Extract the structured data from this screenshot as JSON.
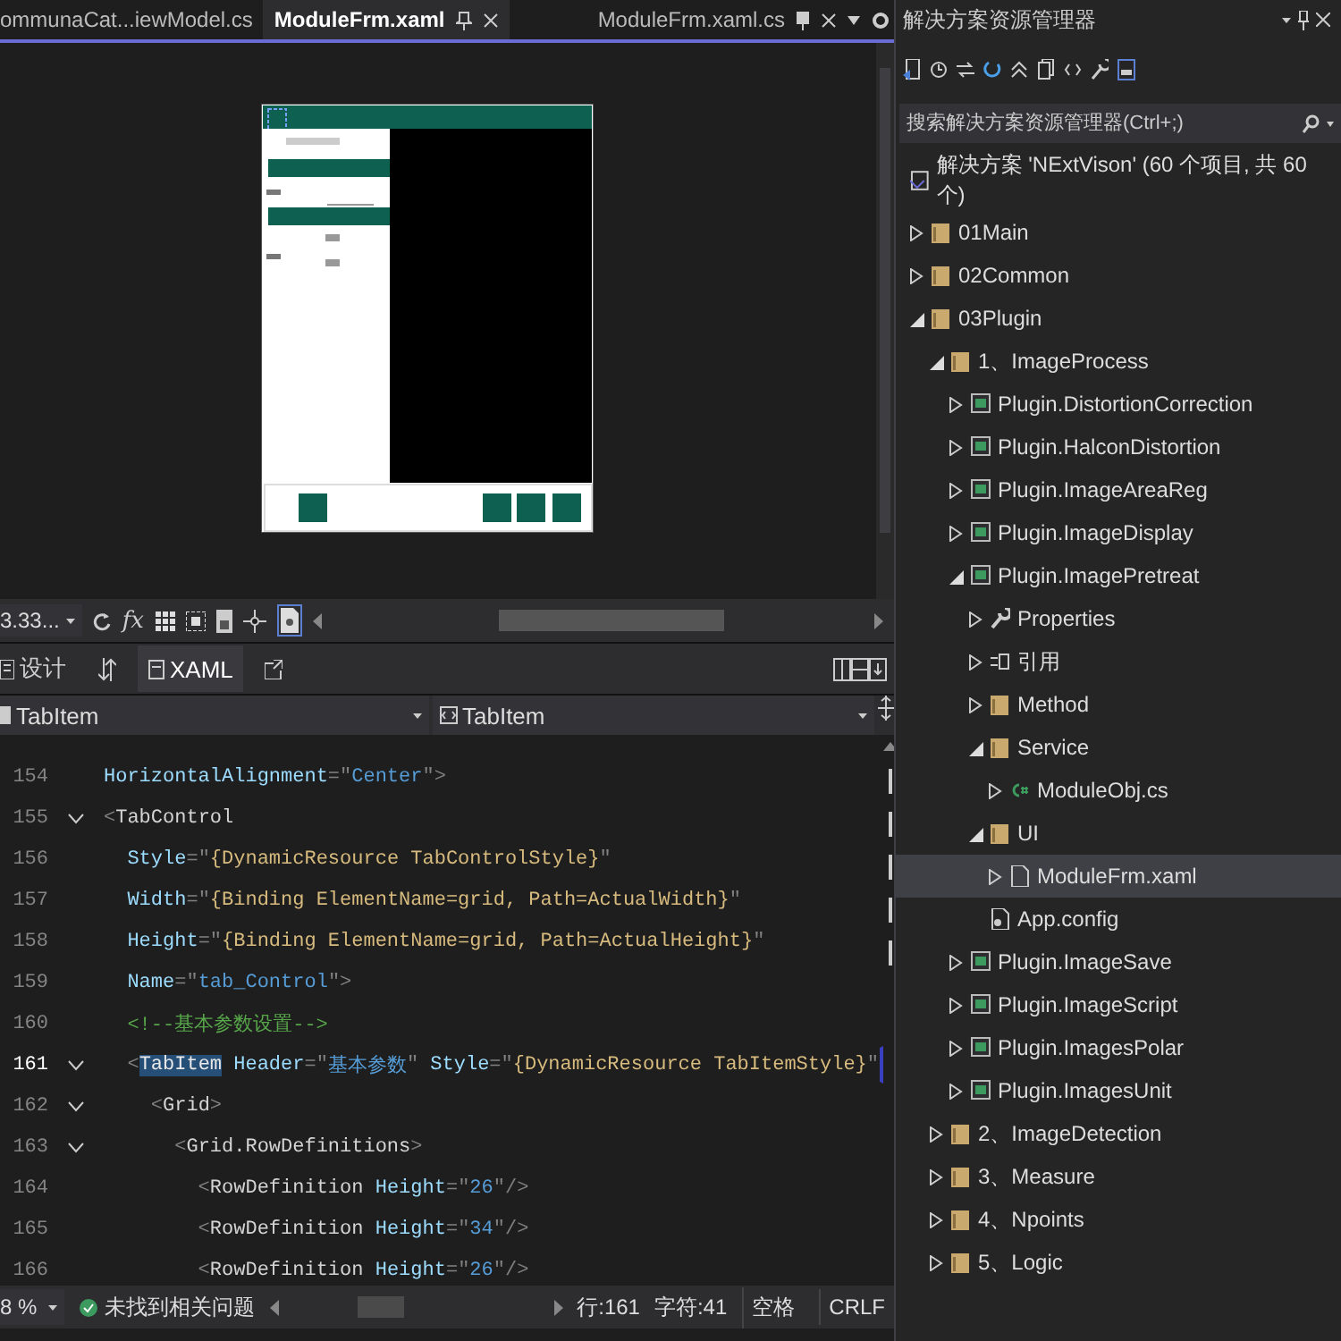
{
  "doc_tabs": [
    {
      "label": "ommunaCat...iewModel.cs",
      "selected": false
    },
    {
      "label": "ModuleFrm.xaml",
      "selected": true
    }
  ],
  "right_tab": "ModuleFrm.xaml.cs",
  "designer_toolbar": {
    "zoom": "3.33...",
    "formula": "fx"
  },
  "view_tabs": [
    {
      "label": "设计",
      "selected": false
    },
    {
      "label": "XAML",
      "selected": true
    }
  ],
  "dropdowns": [
    "TabItem",
    "TabItem"
  ],
  "code": {
    "lines": [
      {
        "number": "154",
        "fold": false,
        "current": false,
        "tokens": [
          {
            "kind": "attr",
            "text": "HorizontalAlignment"
          },
          {
            "kind": "punct",
            "text": "=\""
          },
          {
            "kind": "value",
            "text": "Center"
          },
          {
            "kind": "punct",
            "text": "\">"
          }
        ]
      },
      {
        "number": "155",
        "fold": true,
        "current": false,
        "tokens": [
          {
            "kind": "punct",
            "text": "<"
          },
          {
            "kind": "tag",
            "text": "TabControl"
          }
        ]
      },
      {
        "number": "156",
        "fold": false,
        "current": false,
        "tokens": [
          {
            "kind": "attr",
            "text": "  Style"
          },
          {
            "kind": "punct",
            "text": "=\""
          },
          {
            "kind": "ext",
            "text": "{DynamicResource TabControlStyle}"
          },
          {
            "kind": "punct",
            "text": "\""
          }
        ]
      },
      {
        "number": "157",
        "fold": false,
        "current": false,
        "tokens": [
          {
            "kind": "attr",
            "text": "  Width"
          },
          {
            "kind": "punct",
            "text": "=\""
          },
          {
            "kind": "ext",
            "text": "{Binding ElementName=grid, Path=ActualWidth}"
          },
          {
            "kind": "punct",
            "text": "\""
          }
        ]
      },
      {
        "number": "158",
        "fold": false,
        "current": false,
        "tokens": [
          {
            "kind": "attr",
            "text": "  Height"
          },
          {
            "kind": "punct",
            "text": "=\""
          },
          {
            "kind": "ext",
            "text": "{Binding ElementName=grid, Path=ActualHeight}"
          },
          {
            "kind": "punct",
            "text": "\""
          }
        ]
      },
      {
        "number": "159",
        "fold": false,
        "current": false,
        "tokens": [
          {
            "kind": "attr",
            "text": "  Name"
          },
          {
            "kind": "punct",
            "text": "=\""
          },
          {
            "kind": "value",
            "text": "tab_Control"
          },
          {
            "kind": "punct",
            "text": "\">"
          }
        ]
      },
      {
        "number": "160",
        "fold": false,
        "current": false,
        "tokens": [
          {
            "kind": "comment",
            "text": "  <!--基本参数设置-->"
          }
        ]
      },
      {
        "number": "161",
        "fold": true,
        "current": true,
        "tokens": [
          {
            "kind": "punct",
            "text": "  <"
          },
          {
            "kind": "match",
            "text": "TabItem"
          },
          {
            "kind": "attr",
            "text": " Header"
          },
          {
            "kind": "punct",
            "text": "=\""
          },
          {
            "kind": "value",
            "text": "基本参数"
          },
          {
            "kind": "punct",
            "text": "\""
          },
          {
            "kind": "attr",
            "text": " Style"
          },
          {
            "kind": "punct",
            "text": "=\""
          },
          {
            "kind": "ext",
            "text": "{DynamicResource TabItemStyle}"
          },
          {
            "kind": "punct",
            "text": "\""
          }
        ]
      },
      {
        "number": "162",
        "fold": true,
        "current": false,
        "tokens": [
          {
            "kind": "punct",
            "text": "    <"
          },
          {
            "kind": "tag",
            "text": "Grid"
          },
          {
            "kind": "punct",
            "text": ">"
          }
        ]
      },
      {
        "number": "163",
        "fold": true,
        "current": false,
        "tokens": [
          {
            "kind": "punct",
            "text": "      <"
          },
          {
            "kind": "tag",
            "text": "Grid.RowDefinitions"
          },
          {
            "kind": "punct",
            "text": ">"
          }
        ]
      },
      {
        "number": "164",
        "fold": false,
        "current": false,
        "tokens": [
          {
            "kind": "punct",
            "text": "        <"
          },
          {
            "kind": "tag",
            "text": "RowDefinition"
          },
          {
            "kind": "attr",
            "text": " Height"
          },
          {
            "kind": "punct",
            "text": "=\""
          },
          {
            "kind": "value",
            "text": "26"
          },
          {
            "kind": "punct",
            "text": "\"/>"
          }
        ]
      },
      {
        "number": "165",
        "fold": false,
        "current": false,
        "tokens": [
          {
            "kind": "punct",
            "text": "        <"
          },
          {
            "kind": "tag",
            "text": "RowDefinition"
          },
          {
            "kind": "attr",
            "text": " Height"
          },
          {
            "kind": "punct",
            "text": "=\""
          },
          {
            "kind": "value",
            "text": "34"
          },
          {
            "kind": "punct",
            "text": "\"/>"
          }
        ]
      },
      {
        "number": "166",
        "fold": false,
        "current": false,
        "tokens": [
          {
            "kind": "punct",
            "text": "        <"
          },
          {
            "kind": "tag",
            "text": "RowDefinition"
          },
          {
            "kind": "attr",
            "text": " Height"
          },
          {
            "kind": "punct",
            "text": "=\""
          },
          {
            "kind": "value",
            "text": "26"
          },
          {
            "kind": "punct",
            "text": "\"/>"
          }
        ]
      }
    ]
  },
  "status_bar": {
    "zoom": "8 %",
    "issues": "未找到相关问题",
    "line": "行:161",
    "char": "字符:41",
    "indent": "空格",
    "eol": "CRLF"
  },
  "solution_explorer": {
    "title": "解决方案资源管理器",
    "search": {
      "placeholder": "搜索解决方案资源管理器(Ctrl+;)"
    },
    "tree": [
      {
        "kind": "solution",
        "label": "解决方案 'NExtVison' (60 个项目, 共 60 个)",
        "selected": false,
        "children": [
          {
            "kind": "folder",
            "label": "01Main",
            "expanded": false,
            "selected": false
          },
          {
            "kind": "folder",
            "label": "02Common",
            "expanded": false,
            "selected": false
          },
          {
            "kind": "folder",
            "label": "03Plugin",
            "expanded": true,
            "selected": false,
            "children": [
              {
                "kind": "folder",
                "label": "1、ImageProcess",
                "expanded": true,
                "selected": false,
                "children": [
                  {
                    "kind": "project",
                    "label": "Plugin.DistortionCorrection",
                    "expanded": false,
                    "selected": false
                  },
                  {
                    "kind": "project",
                    "label": "Plugin.HalconDistortion",
                    "expanded": false,
                    "selected": false
                  },
                  {
                    "kind": "project",
                    "label": "Plugin.ImageAreaReg",
                    "expanded": false,
                    "selected": false
                  },
                  {
                    "kind": "project",
                    "label": "Plugin.ImageDisplay",
                    "expanded": false,
                    "selected": false
                  },
                  {
                    "kind": "project",
                    "label": "Plugin.ImagePretreat",
                    "expanded": true,
                    "selected": false,
                    "children": [
                      {
                        "kind": "properties",
                        "label": "Properties",
                        "expanded": false,
                        "selected": false
                      },
                      {
                        "kind": "references",
                        "label": "引用",
                        "expanded": false,
                        "selected": false
                      },
                      {
                        "kind": "folder",
                        "label": "Method",
                        "expanded": false,
                        "selected": false
                      },
                      {
                        "kind": "folder",
                        "label": "Service",
                        "expanded": true,
                        "selected": false,
                        "children": [
                          {
                            "kind": "csfile",
                            "label": "ModuleObj.cs",
                            "expanded": false,
                            "selected": false
                          }
                        ]
                      },
                      {
                        "kind": "folder",
                        "label": "UI",
                        "expanded": true,
                        "selected": false,
                        "children": [
                          {
                            "kind": "xaml",
                            "label": "ModuleFrm.xaml",
                            "expanded": false,
                            "selected": true
                          }
                        ]
                      },
                      {
                        "kind": "config",
                        "label": "App.config",
                        "selected": false
                      }
                    ]
                  },
                  {
                    "kind": "project",
                    "label": "Plugin.ImageSave",
                    "expanded": false,
                    "selected": false
                  },
                  {
                    "kind": "project",
                    "label": "Plugin.ImageScript",
                    "expanded": false,
                    "selected": false
                  },
                  {
                    "kind": "project",
                    "label": "Plugin.ImagesPolar",
                    "expanded": false,
                    "selected": false
                  },
                  {
                    "kind": "project",
                    "label": "Plugin.ImagesUnit",
                    "expanded": false,
                    "selected": false
                  }
                ]
              },
              {
                "kind": "folder",
                "label": "2、ImageDetection",
                "expanded": false,
                "selected": false
              },
              {
                "kind": "folder",
                "label": "3、Measure",
                "expanded": false,
                "selected": false
              },
              {
                "kind": "folder",
                "label": "4、Npoints",
                "expanded": false,
                "selected": false
              },
              {
                "kind": "folder",
                "label": "5、Logic",
                "expanded": false,
                "selected": false
              }
            ]
          }
        ]
      }
    ]
  }
}
